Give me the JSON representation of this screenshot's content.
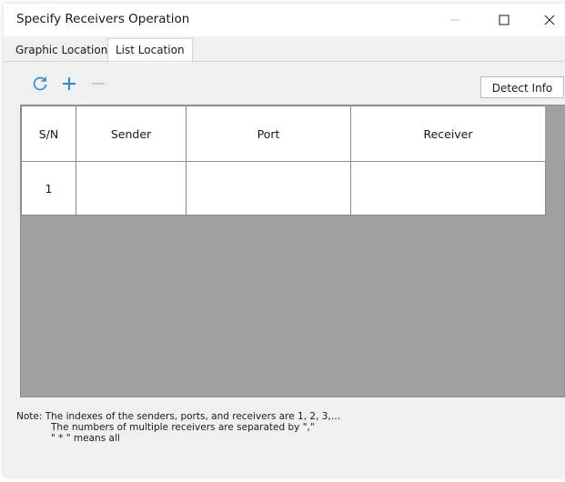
{
  "window": {
    "title": "Specify Receivers Operation"
  },
  "tabs": [
    {
      "label": "Graphic Location",
      "active": false
    },
    {
      "label": "List Location",
      "active": true
    }
  ],
  "toolbar": {
    "refresh_icon": "refresh-icon",
    "add_icon": "plus-icon",
    "remove_icon": "minus-icon",
    "detect_label": "Detect Info",
    "accent_color": "#2b88d8"
  },
  "grid": {
    "columns": [
      "S/N",
      "Sender",
      "Port",
      "Receiver"
    ],
    "rows": [
      {
        "sn": "1",
        "sender": "",
        "port": "",
        "receiver": ""
      }
    ]
  },
  "note": {
    "line1": "Note: The indexes of the senders, ports, and receivers are 1, 2, 3,…",
    "line2": "The numbers of multiple receivers are separated by \",\"",
    "line3": "\" * \" means all"
  }
}
